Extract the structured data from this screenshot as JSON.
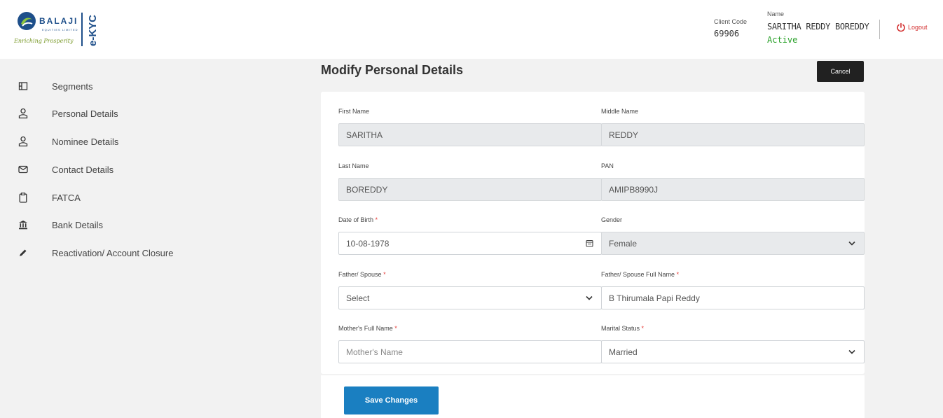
{
  "brand": {
    "name": "BALAJI",
    "subtitle": "EQUITIES LIMITED",
    "tagline": "Enriching Prosperity",
    "product": "e-KYC",
    "accent_blue": "#1e4f8a",
    "accent_green": "#7a9a2a"
  },
  "header": {
    "client_code_label": "Client Code",
    "client_code": "69906",
    "name_label": "Name",
    "name": "SARITHA REDDY BOREDDY",
    "status": "Active",
    "logout_label": "Logout"
  },
  "sidebar": {
    "items": [
      {
        "label": "Segments",
        "icon": "segments-icon"
      },
      {
        "label": "Personal Details",
        "icon": "user-icon"
      },
      {
        "label": "Nominee Details",
        "icon": "user-icon"
      },
      {
        "label": "Contact Details",
        "icon": "envelope-icon"
      },
      {
        "label": "FATCA",
        "icon": "clipboard-icon"
      },
      {
        "label": "Bank Details",
        "icon": "bank-icon"
      },
      {
        "label": "Reactivation/ Account Closure",
        "icon": "pencil-icon"
      }
    ]
  },
  "main": {
    "title": "Modify Personal Details",
    "cancel_label": "Cancel",
    "save_label": "Save Changes",
    "fields": {
      "first_name": {
        "label": "First Name",
        "value": "SARITHA"
      },
      "middle_name": {
        "label": "Middle Name",
        "value": "REDDY"
      },
      "last_name": {
        "label": "Last Name",
        "value": "BOREDDY"
      },
      "pan": {
        "label": "PAN",
        "value": "AMIPB8990J"
      },
      "dob": {
        "label": "Date of Birth",
        "value": "10-08-1978"
      },
      "gender": {
        "label": "Gender",
        "value": "Female"
      },
      "father_spouse": {
        "label": "Father/ Spouse",
        "value": "Select"
      },
      "father_spouse_name": {
        "label": "Father/ Spouse Full Name",
        "value": "B Thirumala Papi Reddy"
      },
      "mother_name": {
        "label": "Mother's Full Name",
        "placeholder": "Mother's Name"
      },
      "marital_status": {
        "label": "Marital Status",
        "value": "Married"
      }
    },
    "required_mark": "*"
  }
}
